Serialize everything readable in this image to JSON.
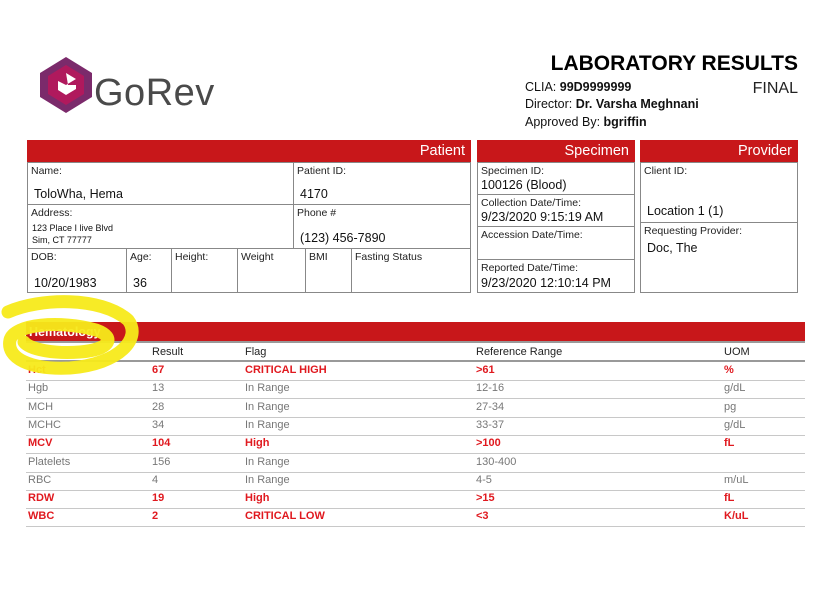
{
  "logo": {
    "text": "GoRev",
    "colors": [
      "#7b2a6b",
      "#b0195d",
      "#5a1f60"
    ]
  },
  "header": {
    "title": "LABORATORY RESULTS",
    "status": "FINAL",
    "clia_label": "CLIA:",
    "clia_value": "99D9999999",
    "director_label": "Director:",
    "director_value": "Dr. Varsha Meghnani",
    "approved_label": "Approved By:",
    "approved_value": "bgriffin"
  },
  "patient": {
    "section_title": "Patient",
    "name_label": "Name:",
    "name_value": "ToloWha, Hema",
    "patient_id_label": "Patient ID:",
    "patient_id_value": "4170",
    "address_label": "Address:",
    "address_line1": "123 Place I live Blvd",
    "address_line2": "Sim, CT 77777",
    "phone_label": "Phone #",
    "phone_value": "(123) 456-7890",
    "dob_label": "DOB:",
    "dob_value": "10/20/1983",
    "age_label": "Age:",
    "age_value": "36",
    "height_label": "Height:",
    "weight_label": "Weight",
    "bmi_label": "BMI",
    "fasting_label": "Fasting Status"
  },
  "specimen": {
    "section_title": "Specimen",
    "id_label": "Specimen ID:",
    "id_value": "100126 (Blood)",
    "collection_label": "Collection Date/Time:",
    "collection_value": "9/23/2020 9:15:19 AM",
    "accession_label": "Accession Date/Time:",
    "reported_label": "Reported Date/Time:",
    "reported_value": "9/23/2020 12:10:14 PM"
  },
  "provider": {
    "section_title": "Provider",
    "client_label": "Client ID:",
    "client_value": "Location 1 (1)",
    "requesting_label": "Requesting Provider:",
    "requesting_value": "Doc, The"
  },
  "hematology": {
    "title": "Hematology",
    "columns": [
      "Result",
      "Flag",
      "Reference Range",
      "UOM"
    ],
    "rows": [
      {
        "test": "Hct",
        "result": "67",
        "flag": "CRITICAL HIGH",
        "range": ">61",
        "uom": "%",
        "abnormal": true
      },
      {
        "test": "Hgb",
        "result": "13",
        "flag": "In Range",
        "range": "12-16",
        "uom": "g/dL",
        "abnormal": false
      },
      {
        "test": "MCH",
        "result": "28",
        "flag": "In Range",
        "range": "27-34",
        "uom": "pg",
        "abnormal": false
      },
      {
        "test": "MCHC",
        "result": "34",
        "flag": "In Range",
        "range": "33-37",
        "uom": "g/dL",
        "abnormal": false
      },
      {
        "test": "MCV",
        "result": "104",
        "flag": "High",
        "range": ">100",
        "uom": "fL",
        "abnormal": true
      },
      {
        "test": "Platelets",
        "result": "156",
        "flag": "In Range",
        "range": "130-400",
        "uom": "",
        "abnormal": false
      },
      {
        "test": "RBC",
        "result": "4",
        "flag": "In Range",
        "range": "4-5",
        "uom": "m/uL",
        "abnormal": false
      },
      {
        "test": "RDW",
        "result": "19",
        "flag": "High",
        "range": ">15",
        "uom": "fL",
        "abnormal": true
      },
      {
        "test": "WBC",
        "result": "2",
        "flag": "CRITICAL LOW",
        "range": "<3",
        "uom": "K/uL",
        "abnormal": true
      }
    ]
  },
  "colors": {
    "accent_red": "#c8171a",
    "abnormal_text": "#e0191f",
    "highlight": "#f7ea1a"
  }
}
